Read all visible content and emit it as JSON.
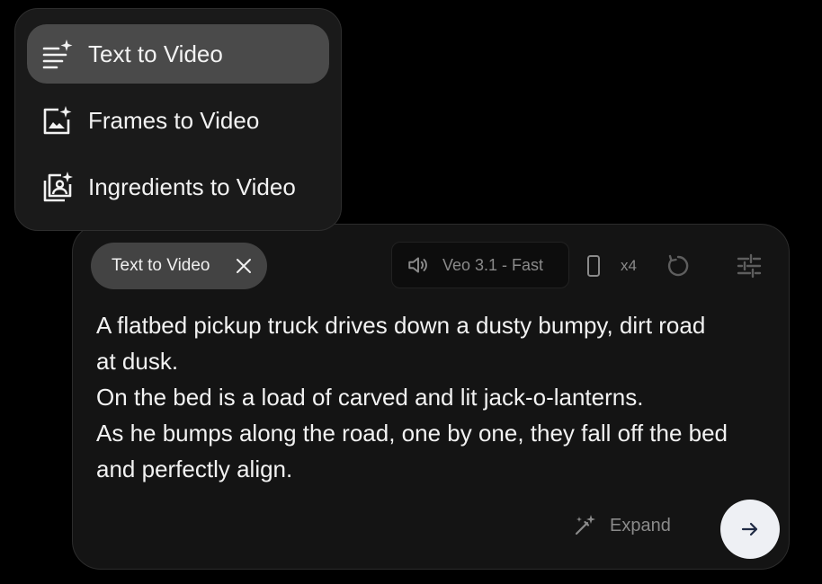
{
  "menu": {
    "items": [
      {
        "label": "Text to Video",
        "icon": "text-sparkle-icon",
        "selected": true
      },
      {
        "label": "Frames to Video",
        "icon": "image-sparkle-icon",
        "selected": false
      },
      {
        "label": "Ingredients to Video",
        "icon": "gallery-person-sparkle-icon",
        "selected": false
      }
    ]
  },
  "prompt_panel": {
    "mode_chip": {
      "label": "Text to Video",
      "close_icon": "close-icon"
    },
    "model_selector": {
      "label": "Veo 3.1 - Fast",
      "icon": "sound-on-icon"
    },
    "aspect": {
      "icon": "portrait-phone-icon",
      "count_label": "x4"
    },
    "refresh_icon": "refresh-icon",
    "settings_icon": "sliders-icon",
    "prompt_text": "A flatbed pickup truck drives down a dusty bumpy, dirt road\nat dusk.\nOn the bed is a load of carved and lit jack-o-lanterns.\nAs he bumps along the road, one by one, they fall off the bed\nand perfectly align.",
    "expand": {
      "label": "Expand",
      "icon": "magic-wand-icon"
    },
    "send_icon": "arrow-right-icon"
  },
  "colors": {
    "background": "#000000",
    "panel": "#141414",
    "menu": "#1a1a1a",
    "chip": "#434343",
    "active_item": "#4a4a4a",
    "muted_text": "#8a8a8a",
    "send_button": "#eef0f4"
  }
}
